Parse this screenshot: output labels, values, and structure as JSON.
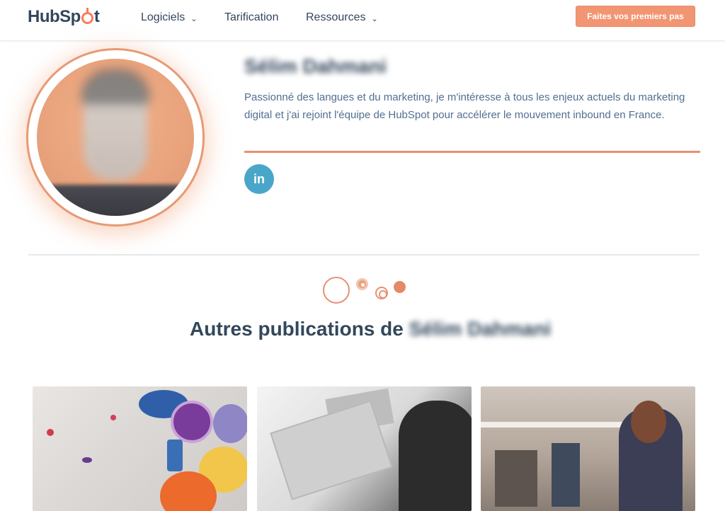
{
  "nav": {
    "logo_text": "HubSpot",
    "items": [
      {
        "label": "Logiciels",
        "has_dropdown": true
      },
      {
        "label": "Tarification",
        "has_dropdown": false
      },
      {
        "label": "Ressources",
        "has_dropdown": true
      }
    ],
    "cta_label": "Faites vos premiers pas",
    "accent_color": "#f19573"
  },
  "profile": {
    "name": "Sélim Dahmani",
    "bio": "Passionné des langues et du marketing, je m'intéresse à tous les enjeux actuels du marketing digital et j'ai rejoint l'équipe de HubSpot pour accélérer le mouvement inbound en France.",
    "social": {
      "icon": "linkedin-icon",
      "label": "in",
      "color": "#4aa6c8"
    }
  },
  "section": {
    "heading_prefix": "Autres publications de",
    "heading_name": "Sélim Dahmani"
  },
  "cards": [
    {
      "image": "paint-palettes-image"
    },
    {
      "image": "laptop-work-image"
    },
    {
      "image": "shop-woman-tablet-image"
    }
  ]
}
